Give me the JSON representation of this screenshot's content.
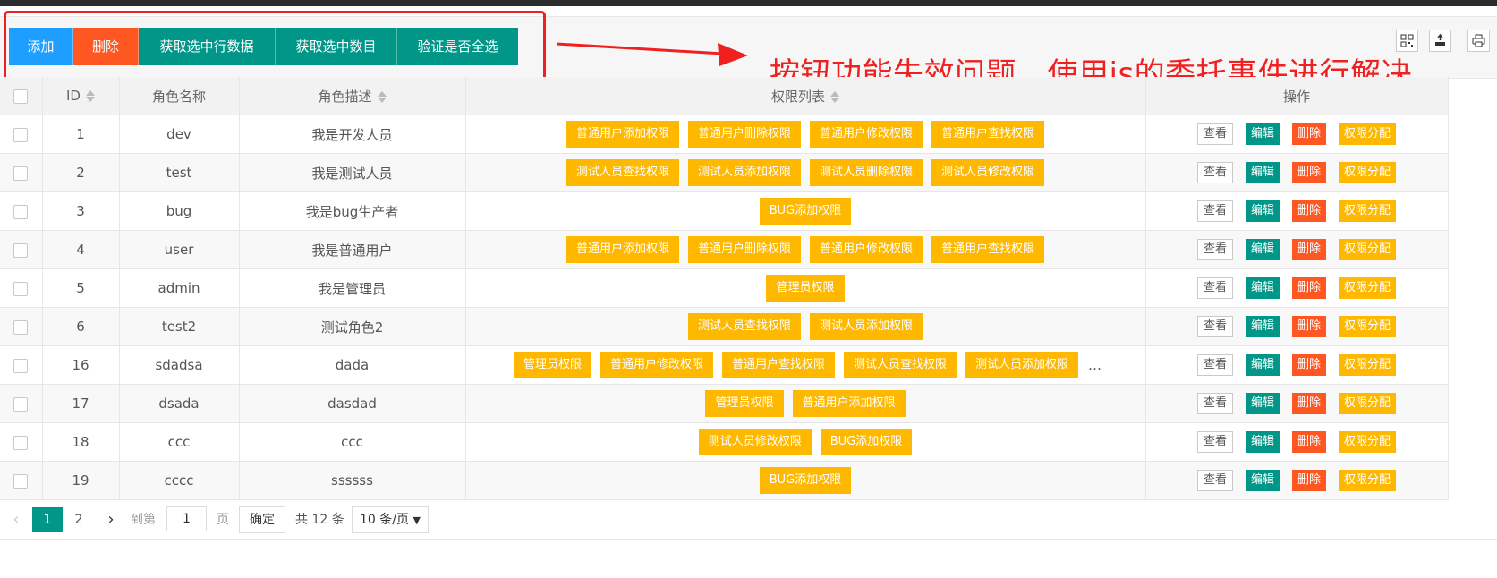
{
  "toolbar": {
    "buttons": [
      {
        "label": "添加",
        "color": "#1E9FFF"
      },
      {
        "label": "删除",
        "color": "#FF5722"
      },
      {
        "label": "获取选中行数据",
        "color": "#009688"
      },
      {
        "label": "获取选中数目",
        "color": "#009688"
      },
      {
        "label": "验证是否全选",
        "color": "#009688"
      }
    ],
    "right_icons": [
      "columns-icon",
      "export-icon",
      "print-icon"
    ]
  },
  "annotation": {
    "text": "按钮功能失效问题，使用js的委托事件进行解决",
    "color": "#f02020"
  },
  "table": {
    "columns": [
      "ID",
      "角色名称",
      "角色描述",
      "权限列表",
      "操作"
    ],
    "actions": {
      "view": "查看",
      "edit": "编辑",
      "delete": "删除",
      "assign": "权限分配"
    },
    "rows": [
      {
        "id": "1",
        "name": "dev",
        "desc": "我是开发人员",
        "perms": [
          "普通用户添加权限",
          "普通用户删除权限",
          "普通用户修改权限",
          "普通用户查找权限"
        ],
        "more": ""
      },
      {
        "id": "2",
        "name": "test",
        "desc": "我是测试人员",
        "perms": [
          "测试人员查找权限",
          "测试人员添加权限",
          "测试人员删除权限",
          "测试人员修改权限"
        ],
        "more": ""
      },
      {
        "id": "3",
        "name": "bug",
        "desc": "我是bug生产者",
        "perms": [
          "BUG添加权限"
        ],
        "more": ""
      },
      {
        "id": "4",
        "name": "user",
        "desc": "我是普通用户",
        "perms": [
          "普通用户添加权限",
          "普通用户删除权限",
          "普通用户修改权限",
          "普通用户查找权限"
        ],
        "more": ""
      },
      {
        "id": "5",
        "name": "admin",
        "desc": "我是管理员",
        "perms": [
          "管理员权限"
        ],
        "more": ""
      },
      {
        "id": "6",
        "name": "test2",
        "desc": "测试角色2",
        "perms": [
          "测试人员查找权限",
          "测试人员添加权限"
        ],
        "more": ""
      },
      {
        "id": "16",
        "name": "sdadsa",
        "desc": "dada",
        "perms": [
          "管理员权限",
          "普通用户修改权限",
          "普通用户查找权限",
          "测试人员查找权限",
          "测试人员添加权限"
        ],
        "more": "…"
      },
      {
        "id": "17",
        "name": "dsada",
        "desc": "dasdad",
        "perms": [
          "管理员权限",
          "普通用户添加权限"
        ],
        "more": ""
      },
      {
        "id": "18",
        "name": "ccc",
        "desc": "ccc",
        "perms": [
          "测试人员修改权限",
          "BUG添加权限"
        ],
        "more": ""
      },
      {
        "id": "19",
        "name": "cccc",
        "desc": "ssssss",
        "perms": [
          "BUG添加权限"
        ],
        "more": ""
      }
    ]
  },
  "pagination": {
    "pages": [
      "1",
      "2"
    ],
    "current": "1",
    "goto_label": "到第",
    "goto_value": "1",
    "page_unit": "页",
    "confirm": "确定",
    "total": "共 12 条",
    "page_size": "10 条/页"
  }
}
